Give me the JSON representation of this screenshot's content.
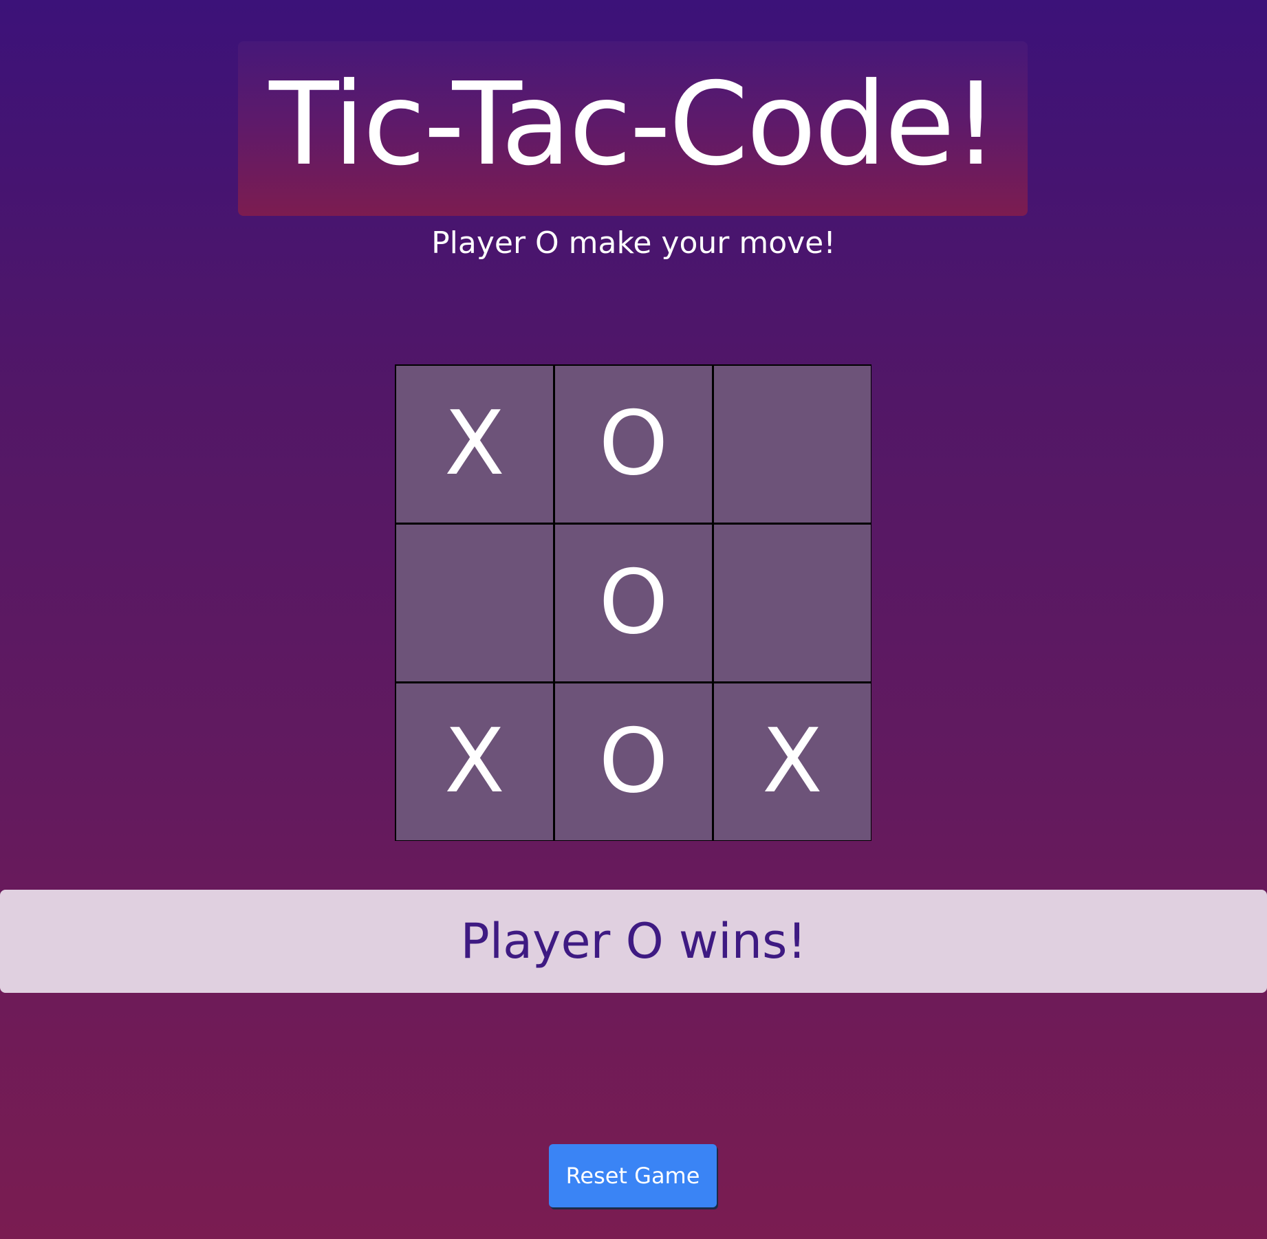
{
  "header": {
    "title": "Tic-Tac-Code!"
  },
  "status": {
    "turn_message": "Player O make your move!"
  },
  "board": {
    "cells": [
      "X",
      "O",
      "",
      "",
      "O",
      "",
      "X",
      "O",
      "X"
    ]
  },
  "result": {
    "message": "Player O wins!"
  },
  "controls": {
    "reset_label": "Reset Game"
  },
  "colors": {
    "background_top": "#3c1279",
    "background_bottom": "#7a1c51",
    "cell": "#8a5c9a",
    "banner": "#e0d0e0",
    "banner_text": "#3e1a82",
    "button": "#3a84f5"
  }
}
